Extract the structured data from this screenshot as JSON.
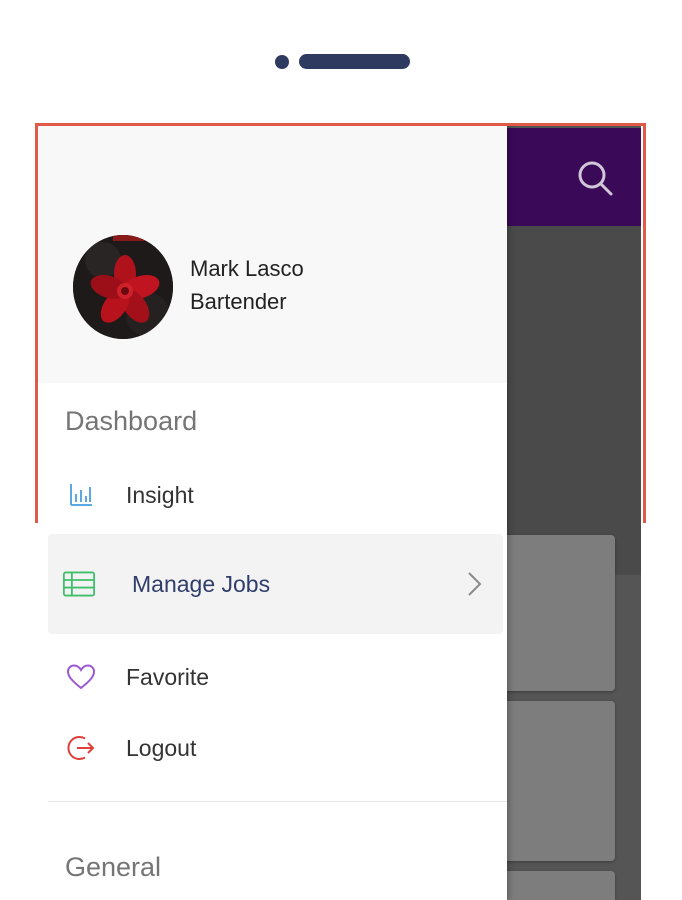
{
  "user": {
    "name": "Mark Lasco",
    "role": "Bartender"
  },
  "drawer": {
    "section_dashboard": "Dashboard",
    "section_general": "General",
    "items": [
      {
        "label": "Insight",
        "icon": "bar-chart-icon"
      },
      {
        "label": "Manage Jobs",
        "icon": "table-list-icon",
        "active": true
      },
      {
        "label": "Favorite",
        "icon": "heart-icon"
      },
      {
        "label": "Logout",
        "icon": "logout-icon"
      }
    ]
  },
  "appbar": {
    "icon": "search-icon"
  },
  "colors": {
    "appbar": "#3a0a58",
    "active_label": "#2f3d6b",
    "insight_icon": "#5aa9e6",
    "jobs_icon": "#3fbf6a",
    "favorite_icon": "#9b59d0",
    "logout_icon": "#e0403a"
  }
}
